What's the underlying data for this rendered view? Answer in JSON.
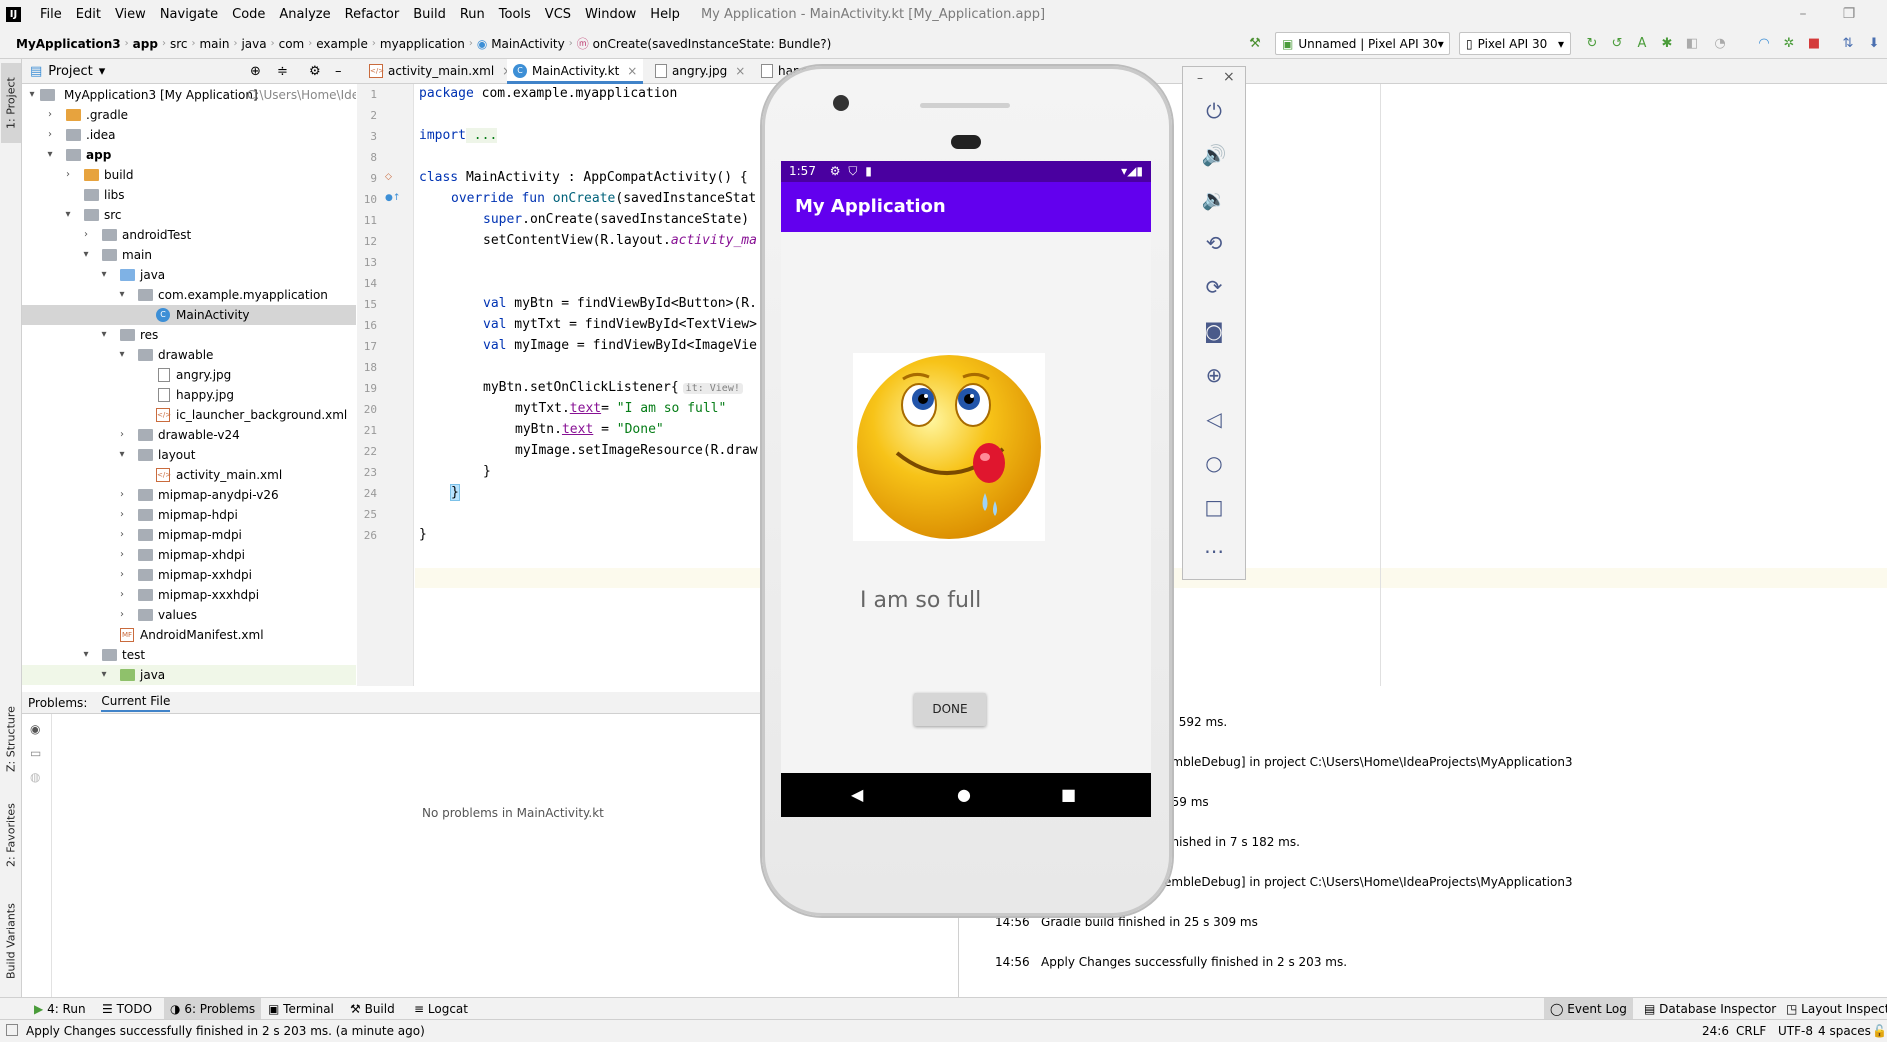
{
  "menubar": {
    "items": [
      "File",
      "Edit",
      "View",
      "Navigate",
      "Code",
      "Analyze",
      "Refactor",
      "Build",
      "Run",
      "Tools",
      "VCS",
      "Window",
      "Help"
    ],
    "window_title": "My Application - MainActivity.kt [My_Application.app]"
  },
  "breadcrumb": [
    "MyApplication3",
    "app",
    "src",
    "main",
    "java",
    "com",
    "example",
    "myapplication",
    "MainActivity",
    "onCreate(savedInstanceState: Bundle?)"
  ],
  "toolbar": {
    "run_config": "Unnamed | Pixel API 30",
    "device": "Pixel API 30"
  },
  "left_strip": {
    "project": "1: Project",
    "structure": "Z: Structure",
    "favorites": "2: Favorites",
    "build_variants": "Build Variants"
  },
  "project_panel": {
    "title": "Project",
    "tree": [
      {
        "label": "MyApplication3 [My Application]",
        "hint": "C:\\Users\\Home\\IdeaProjects\\MyApplication3"
      },
      {
        "label": ".gradle"
      },
      {
        "label": ".idea"
      },
      {
        "label": "app"
      },
      {
        "label": "build"
      },
      {
        "label": "libs"
      },
      {
        "label": "src"
      },
      {
        "label": "androidTest"
      },
      {
        "label": "main"
      },
      {
        "label": "java"
      },
      {
        "label": "com.example.myapplication"
      },
      {
        "label": "MainActivity"
      },
      {
        "label": "res"
      },
      {
        "label": "drawable"
      },
      {
        "label": "angry.jpg"
      },
      {
        "label": "happy.jpg"
      },
      {
        "label": "ic_launcher_background.xml"
      },
      {
        "label": "drawable-v24"
      },
      {
        "label": "layout"
      },
      {
        "label": "activity_main.xml"
      },
      {
        "label": "mipmap-anydpi-v26"
      },
      {
        "label": "mipmap-hdpi"
      },
      {
        "label": "mipmap-mdpi"
      },
      {
        "label": "mipmap-xhdpi"
      },
      {
        "label": "mipmap-xxhdpi"
      },
      {
        "label": "mipmap-xxxhdpi"
      },
      {
        "label": "values"
      },
      {
        "label": "AndroidManifest.xml"
      },
      {
        "label": "test"
      },
      {
        "label": "java"
      }
    ]
  },
  "editor_tabs": [
    "activity_main.xml",
    "MainActivity.kt",
    "angry.jpg",
    "happy.jpg"
  ],
  "code": {
    "line_numbers": [
      "1",
      "2",
      "3",
      "8",
      "9",
      "10",
      "11",
      "12",
      "13",
      "14",
      "15",
      "16",
      "17",
      "18",
      "19",
      "20",
      "21",
      "22",
      "23",
      "24",
      "25",
      "26"
    ],
    "l1_kw": "package",
    "l1_rest": " com.example.myapplication",
    "l3_kw": "import",
    "l3_rest": " ...",
    "l9_kw": "class",
    "l9_rest": " MainActivity : AppCompatActivity() {",
    "l10_kw": "override fun",
    "l10_fn": " onCreate",
    "l10_rest": "(savedInstanceStat",
    "l11_kw": "super",
    "l11_rest": ".onCreate(savedInstanceState)",
    "l12_a": "setContentView(R.layout.",
    "l12_it": "activity_ma",
    "l15_kw": "val",
    "l15_rest": " myBtn = findViewById<Button>(R.",
    "l16_kw": "val",
    "l16_rest": " mytTxt = findViewById<TextView>",
    "l17_kw": "val",
    "l17_rest": " myImage = findViewById<ImageVie",
    "l19_a": "myBtn.setOnClickListener{",
    "l19_hint": "it: View!",
    "l20_a": "mytTxt.",
    "l20_prop": "text",
    "l20_b": "= ",
    "l20_str": "\"I am so full\"",
    "l21_a": "myBtn.",
    "l21_prop": "text",
    "l21_b": " = ",
    "l21_str": "\"Done\"",
    "l22_a": "myImage.setImageResource(R.draw",
    "l23": "}",
    "l24": "}",
    "l26": "}"
  },
  "problems": {
    "tab1": "Problems:",
    "tab2": "Current File",
    "empty": "No problems in MainActivity.kt"
  },
  "build_log": [
    {
      "text": "in 592 ms."
    },
    {
      "text": "embleDebug] in project C:\\Users\\Home\\IdeaProjects\\MyApplication3"
    },
    {
      "text": "459 ms"
    },
    {
      "text": "finished in 7 s 182 ms."
    },
    {
      "text": "embleDebug] in project C:\\Users\\Home\\IdeaProjects\\MyApplication3"
    },
    {
      "time": "14:56",
      "text": "Gradle build finished in 25 s 309 ms"
    },
    {
      "time": "14:56",
      "text": "Apply Changes successfully finished in 2 s 203 ms."
    }
  ],
  "bottom_tabs": [
    "4: Run",
    "TODO",
    "6: Problems",
    "Terminal",
    "Build",
    "Logcat"
  ],
  "bottom_right_tabs": [
    "Event Log",
    "Database Inspector",
    "Layout Inspector"
  ],
  "status": {
    "message": "Apply Changes successfully finished in 2 s 203 ms. (a minute ago)",
    "position": "24:6",
    "line_sep": "CRLF",
    "encoding": "UTF-8",
    "indent": "4 spaces"
  },
  "emulator": {
    "time": "1:57",
    "app_title": "My Application",
    "text": "I am so full",
    "button": "DONE"
  },
  "colors": {
    "app_bar": "#6200ee",
    "status_bar": "#4a00a0",
    "accent": "#4083c9"
  }
}
